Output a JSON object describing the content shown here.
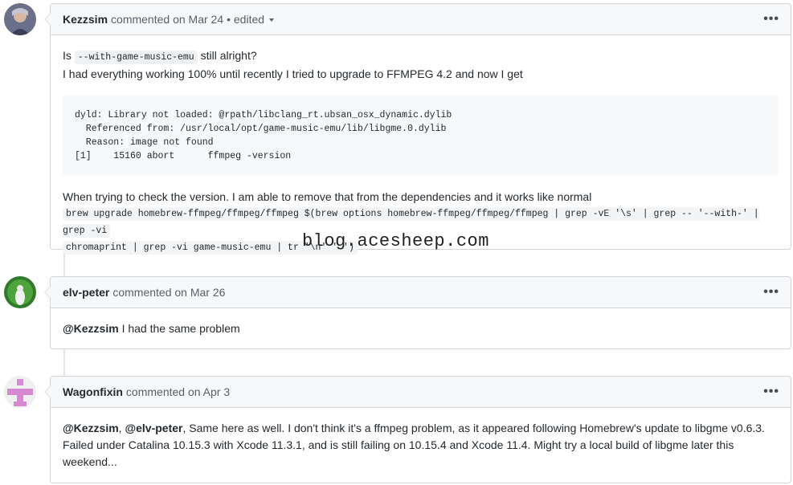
{
  "comments": [
    {
      "author": "Kezzsim",
      "meta": "commented on Mar 24",
      "edited": "• edited",
      "more": "•••",
      "body": {
        "line1_pre": "Is",
        "line1_code": "--with-game-music-emu",
        "line1_post": "still alright?",
        "line2": "I had everything working 100% until recently I tried to upgrade to FFMPEG 4.2 and now I get",
        "code_block": "dyld: Library not loaded: @rpath/libclang_rt.ubsan_osx_dynamic.dylib\n  Referenced from: /usr/local/opt/game-music-emu/lib/libgme.0.dylib\n  Reason: image not found\n[1]    15160 abort      ffmpeg -version",
        "line3": "When trying to check the version. I am able to remove that from the dependencies and it works like normal",
        "cmd_part1": "brew upgrade homebrew-ffmpeg/ffmpeg/ffmpeg $(brew options homebrew-ffmpeg/ffmpeg/ffmpeg | grep -vE '\\s' | grep -- '--with-' | grep -vi",
        "cmd_part2": "chromaprint | grep -vi game-music-emu | tr '\\n' ' ')"
      }
    },
    {
      "author": "elv-peter",
      "meta": "commented on Mar 26",
      "more": "•••",
      "body": {
        "mention": "@Kezzsim",
        "text": "I had the same problem"
      }
    },
    {
      "author": "Wagonfixin",
      "meta": "commented on Apr 3",
      "more": "•••",
      "body": {
        "mention1": "@Kezzsim",
        "sep": ",",
        "mention2": "@elv-peter",
        "text": ", Same here as well. I don't think it's a ffmpeg problem, as it appeared following Homebrew's update to libgme v0.6.3. Failed under Catalina 10.15.3 with Xcode 11.3.1, and is still failing on 10.15.4 and Xcode 11.4. Might try a local build of libgme later this weekend..."
      }
    }
  ],
  "watermark": "blog.acesheep.com",
  "colors": {
    "border": "#d1d5da",
    "header_bg": "#f6f8fa",
    "text": "#24292e",
    "muted": "#586069"
  }
}
